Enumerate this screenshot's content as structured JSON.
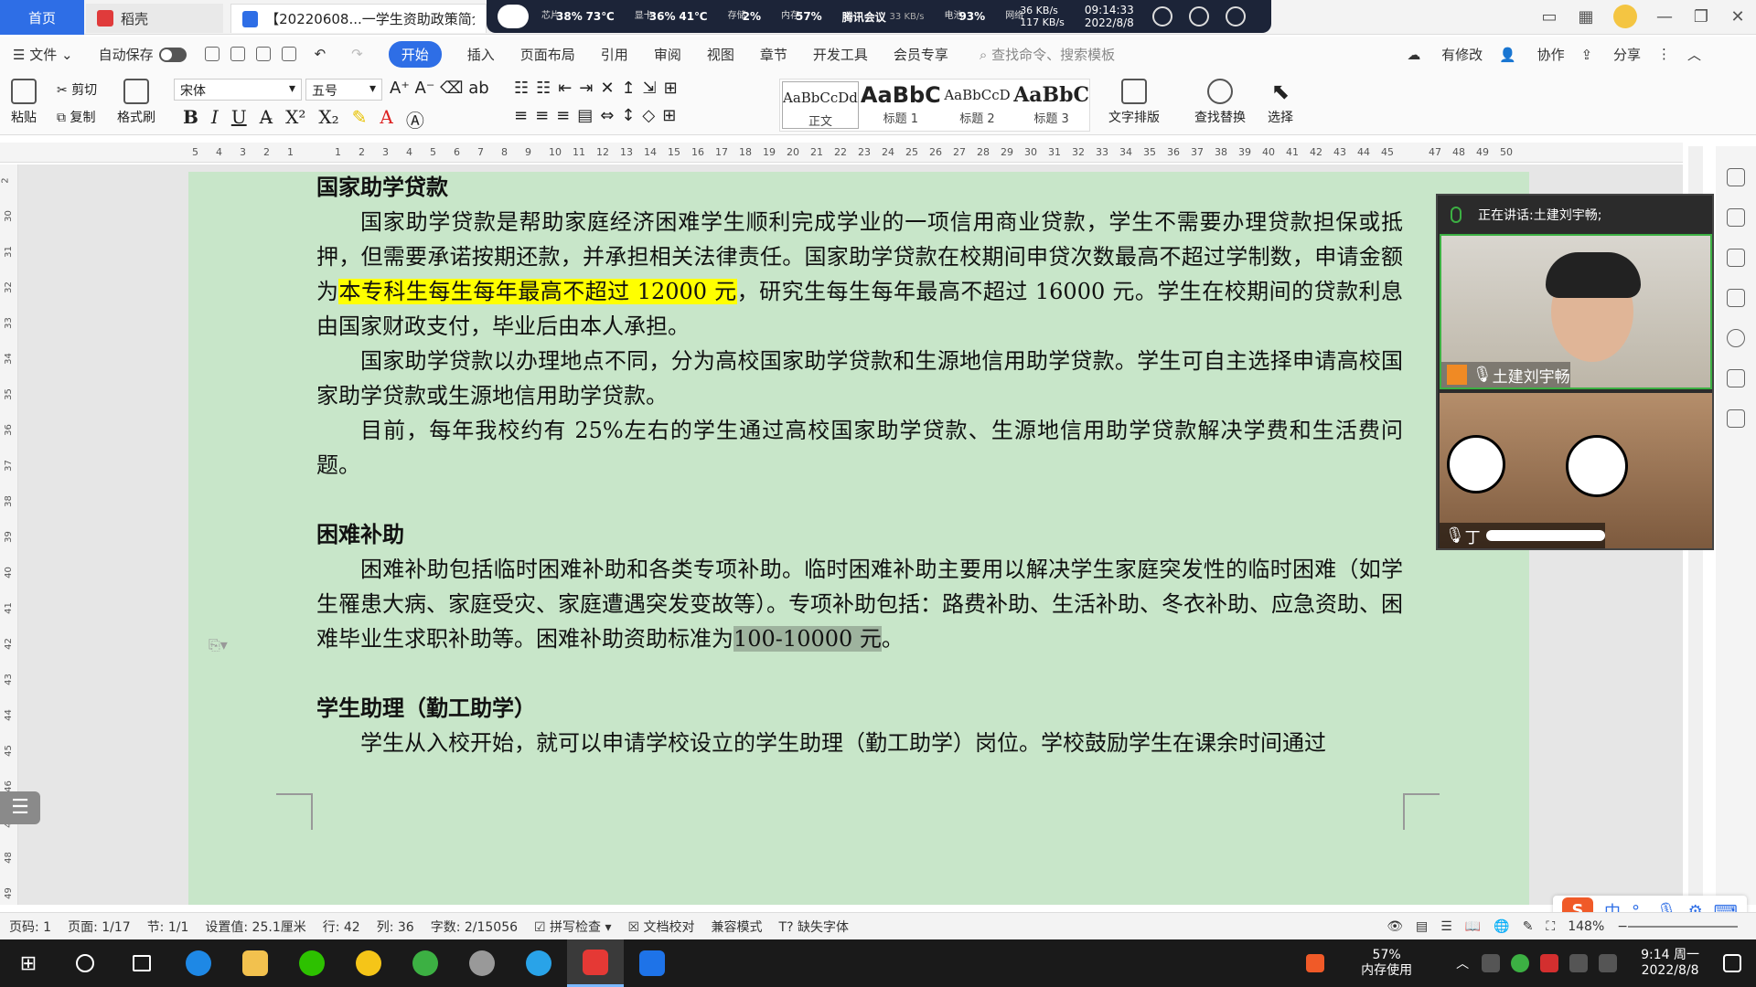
{
  "tabs": {
    "home": "首页",
    "daoke": "稻壳",
    "doc": "【20220608...一学生资助政策简介"
  },
  "sysmon": {
    "cpu_label": "芯片",
    "cpu_usage": "38%",
    "cpu_temp": "73℃",
    "gpu_label": "显卡",
    "gpu_usage": "36%",
    "gpu_temp": "41℃",
    "disk_label": "存储",
    "disk_usage": "2%",
    "mem_label": "内存",
    "mem_usage": "57%",
    "meeting_app": "腾讯会议",
    "meeting_speed": "33 KB/s",
    "battery_label": "电池",
    "battery": "93%",
    "net_label": "网络",
    "net_up": "36 KB/s",
    "net_down": "117 KB/s",
    "time": "09:14:33",
    "date": "2022/8/8"
  },
  "menu": {
    "file": "文件",
    "autosave": "自动保存",
    "items": [
      "开始",
      "插入",
      "页面布局",
      "引用",
      "审阅",
      "视图",
      "章节",
      "开发工具",
      "会员专享"
    ],
    "search_placeholder": "查找命令、搜索模板",
    "modified": "有修改",
    "collab": "协作",
    "share": "分享"
  },
  "ribbon": {
    "paste": "粘贴",
    "cut": "剪切",
    "copy": "复制",
    "format_painter": "格式刷",
    "font_name": "宋体",
    "font_size": "五号",
    "styles": [
      {
        "preview": "AaBbCcDd",
        "name": "正文"
      },
      {
        "preview": "AaBbC",
        "name": "标题 1"
      },
      {
        "preview": "AaBbCcD",
        "name": "标题 2"
      },
      {
        "preview": "AaBbC",
        "name": "标题 3"
      }
    ],
    "text_layout": "文字排版",
    "find_replace": "查找替换",
    "select": "选择"
  },
  "ruler": [
    "5",
    "4",
    "3",
    "2",
    "1",
    "",
    "1",
    "2",
    "3",
    "4",
    "5",
    "6",
    "7",
    "8",
    "9",
    "10",
    "11",
    "12",
    "13",
    "14",
    "15",
    "16",
    "17",
    "18",
    "19",
    "20",
    "21",
    "22",
    "23",
    "24",
    "25",
    "26",
    "27",
    "28",
    "29",
    "30",
    "31",
    "32",
    "33",
    "34",
    "35",
    "36",
    "37",
    "38",
    "39",
    "40",
    "41",
    "42",
    "43",
    "44",
    "45",
    "",
    "47",
    "48",
    "49",
    "50"
  ],
  "left_ruler": [
    "2",
    "30",
    "31",
    "32",
    "33",
    "34",
    "35",
    "36",
    "37",
    "38",
    "39",
    "40",
    "41",
    "42",
    "43",
    "44",
    "45",
    "46",
    "47",
    "48",
    "49"
  ],
  "document": {
    "h1": "国家助学贷款",
    "p1_a": "国家助学贷款是帮助家庭经济困难学生顺利完成学业的一项信用商业贷款，学生不需要办理贷款担保或抵押，但需要承诺按期还款，并承担相关法律责任。国家助学贷款在校期间申贷次数最高不超过学制数，申请金额为",
    "p1_hl": "本专科生每生每年最高不超过 12000 元",
    "p1_b": "，研究生每生每年最高不超过 16000 元。学生在校期间的贷款利息由国家财政支付，毕业后由本人承担。",
    "p2": "国家助学贷款以办理地点不同，分为高校国家助学贷款和生源地信用助学贷款。学生可自主选择申请高校国家助学贷款或生源地信用助学贷款。",
    "p3": "目前，每年我校约有 25%左右的学生通过高校国家助学贷款、生源地信用助学贷款解决学费和生活费问题。",
    "h2": "困难补助",
    "p4_a": "困难补助包括临时困难补助和各类专项补助。临时困难补助主要用以解决学生家庭突发性的临时困难（如学生罹患大病、家庭受灾、家庭遭遇突发变故等）。专项补助包括：路费补助、生活补助、冬衣补助、应急资助、困难毕业生求职补助等。困难补助资助标准为",
    "p4_hl": "100-10000 元",
    "p4_b": "。",
    "h3": "学生助理（勤工助学）",
    "p5": "学生从入校开始，就可以申请学校设立的学生助理（勤工助学）岗位。学校鼓励学生在课余时间通过"
  },
  "meeting": {
    "speaking_prefix": "正在讲话: ",
    "speaker": "土建刘宇畅;",
    "participant1": "土建刘宇畅",
    "participant2": "丁"
  },
  "status": {
    "page_code": "页码: 1",
    "page": "页面: 1/17",
    "section": "节: 1/1",
    "setting": "设置值: 25.1厘米",
    "row": "行: 42",
    "col": "列: 36",
    "words": "字数: 2/15056",
    "spell": "拼写检查",
    "proof": "文档校对",
    "compat": "兼容模式",
    "missing_font": "缺失字体",
    "zoom": "148%"
  },
  "ime": {
    "logo": "S",
    "lang": "中",
    "punct": "°,"
  },
  "tray": {
    "mem_pct": "57%",
    "mem_label": "内存使用",
    "time": "9:14 周一",
    "date": "2022/8/8"
  },
  "colors": {
    "accent": "#2e6ee6",
    "page_bg": "#c8e6c9",
    "highlight": "#ffff00"
  }
}
